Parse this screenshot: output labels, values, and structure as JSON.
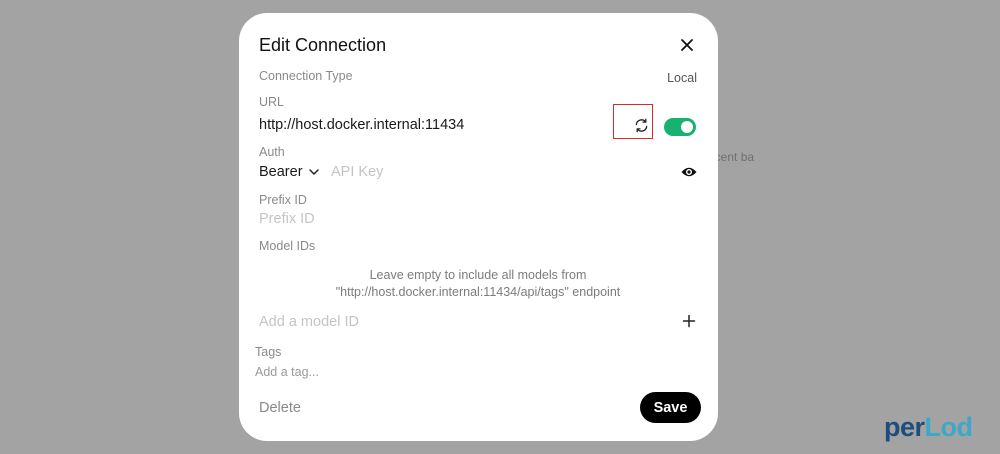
{
  "background": {
    "text": "ecent ba"
  },
  "modal": {
    "title": "Edit Connection",
    "connection_type": {
      "label": "Connection Type",
      "value": "Local"
    },
    "url": {
      "label": "URL",
      "value": "http://host.docker.internal:11434",
      "enabled": true
    },
    "auth": {
      "label": "Auth",
      "type": "Bearer",
      "api_key_placeholder": "API Key"
    },
    "prefix": {
      "label": "Prefix ID",
      "placeholder": "Prefix ID"
    },
    "model_ids": {
      "label": "Model IDs",
      "hint_line1": "Leave empty to include all models from",
      "hint_line2": "\"http://host.docker.internal:11434/api/tags\" endpoint",
      "placeholder": "Add a model ID"
    },
    "tags": {
      "label": "Tags",
      "placeholder": "Add a tag..."
    },
    "delete_label": "Delete",
    "save_label": "Save"
  },
  "logo": {
    "part1": "per",
    "part2": "Lod"
  },
  "colors": {
    "toggle_on": "#17b26f",
    "highlight": "#d62b2b",
    "logo_dark": "#1e4d7b",
    "logo_light": "#3ea8c9"
  }
}
